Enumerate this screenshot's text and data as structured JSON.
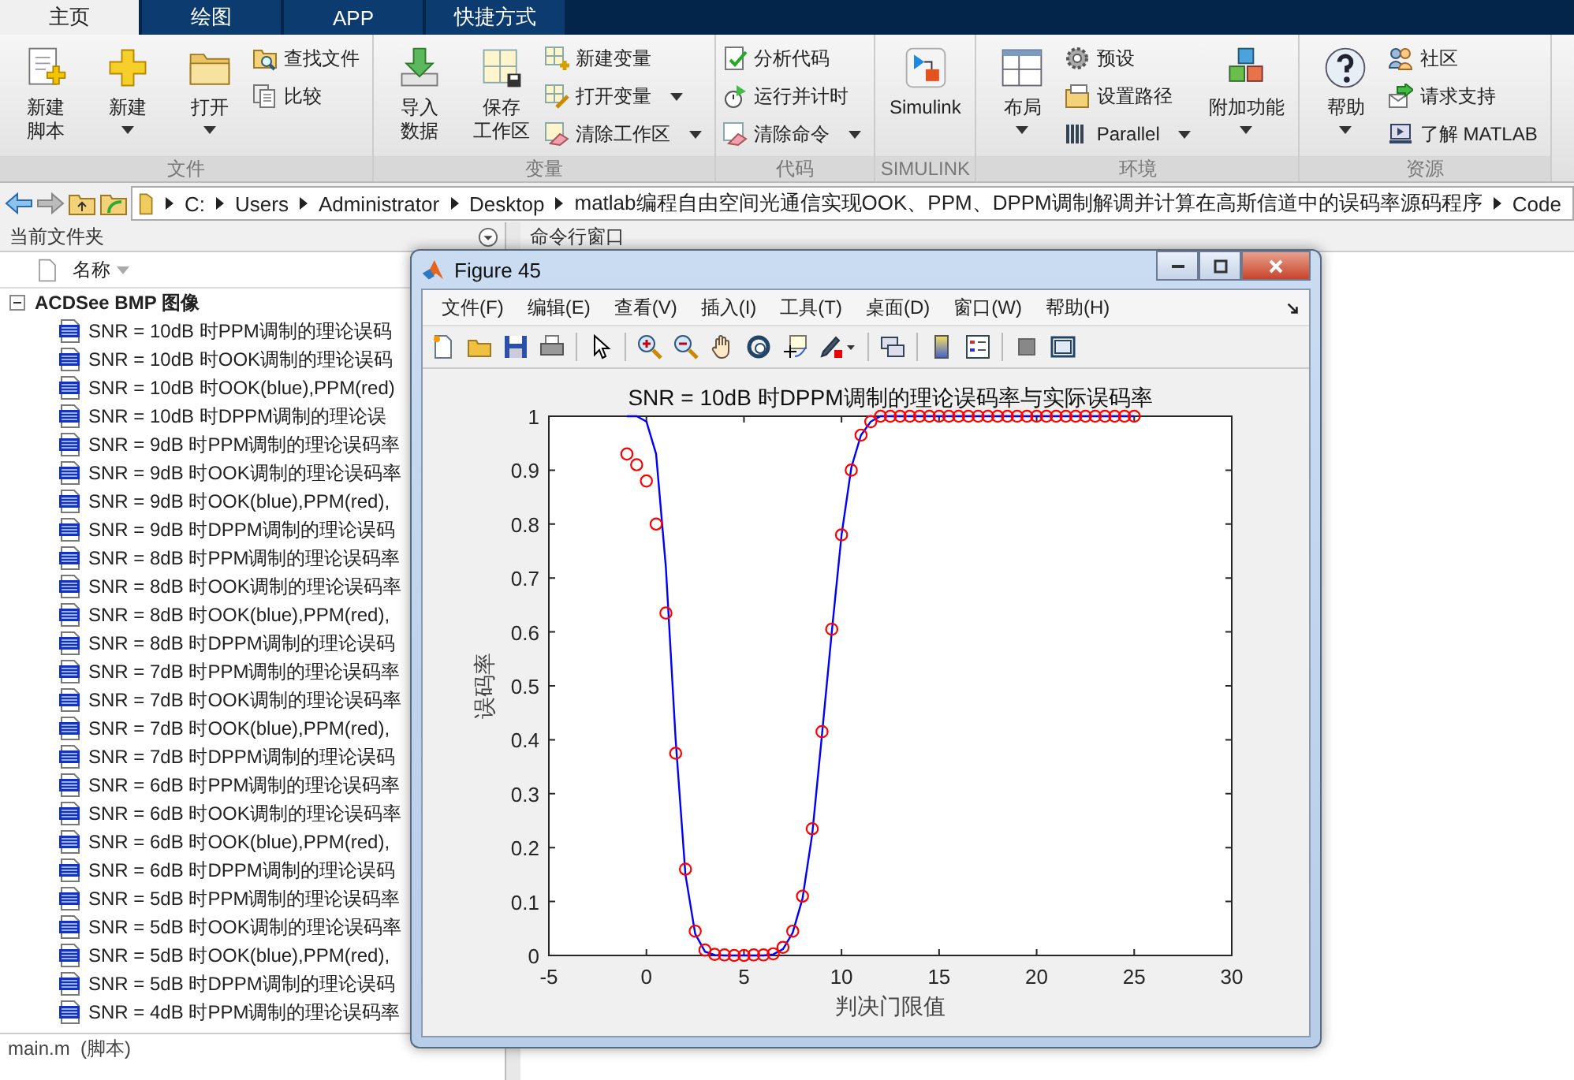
{
  "tabs": [
    {
      "label": "主页",
      "selected": true
    },
    {
      "label": "绘图",
      "selected": false
    },
    {
      "label": "APP",
      "selected": false
    },
    {
      "label": "快捷方式",
      "selected": false
    }
  ],
  "ribbon": {
    "groups": [
      {
        "label": "文件",
        "items": [
          {
            "kind": "large",
            "lines": [
              "新建",
              "脚本"
            ],
            "dropdown": false
          },
          {
            "kind": "large",
            "lines": [
              "新建"
            ],
            "dropdown": true
          },
          {
            "kind": "large",
            "lines": [
              "打开"
            ],
            "dropdown": true
          },
          {
            "kind": "small",
            "lines": [
              "查找文件"
            ],
            "dropdown": false
          },
          {
            "kind": "small",
            "lines": [
              "比较"
            ],
            "dropdown": false
          }
        ]
      },
      {
        "label": "变量",
        "items": [
          {
            "kind": "large",
            "lines": [
              "导入",
              "数据"
            ],
            "dropdown": false
          },
          {
            "kind": "large",
            "lines": [
              "保存",
              "工作区"
            ],
            "dropdown": false
          },
          {
            "kind": "small",
            "lines": [
              "新建变量"
            ],
            "dropdown": false
          },
          {
            "kind": "small",
            "lines": [
              "打开变量"
            ],
            "dropdown": true
          },
          {
            "kind": "small",
            "lines": [
              "清除工作区"
            ],
            "dropdown": true
          }
        ]
      },
      {
        "label": "代码",
        "items": [
          {
            "kind": "small",
            "lines": [
              "分析代码"
            ],
            "dropdown": false
          },
          {
            "kind": "small",
            "lines": [
              "运行并计时"
            ],
            "dropdown": false
          },
          {
            "kind": "small",
            "lines": [
              "清除命令"
            ],
            "dropdown": true
          }
        ]
      },
      {
        "label": "SIMULINK",
        "items": [
          {
            "kind": "large",
            "lines": [
              "Simulink"
            ],
            "dropdown": false
          }
        ]
      },
      {
        "label": "环境",
        "items": [
          {
            "kind": "large",
            "lines": [
              "布局"
            ],
            "dropdown": true
          },
          {
            "kind": "small",
            "lines": [
              "预设"
            ],
            "dropdown": false
          },
          {
            "kind": "small",
            "lines": [
              "设置路径"
            ],
            "dropdown": false
          },
          {
            "kind": "small",
            "lines": [
              "Parallel"
            ],
            "dropdown": true
          },
          {
            "kind": "large",
            "lines": [
              "附加功能"
            ],
            "dropdown": true
          }
        ]
      },
      {
        "label": "资源",
        "items": [
          {
            "kind": "large",
            "lines": [
              "帮助"
            ],
            "dropdown": true
          },
          {
            "kind": "small",
            "lines": [
              "社区"
            ],
            "dropdown": false
          },
          {
            "kind": "small",
            "lines": [
              "请求支持"
            ],
            "dropdown": false
          },
          {
            "kind": "small",
            "lines": [
              "了解 MATLAB"
            ],
            "dropdown": false
          }
        ]
      }
    ]
  },
  "address": {
    "segments": [
      "C:",
      "Users",
      "Administrator",
      "Desktop",
      "matlab编程自由空间光通信实现OOK、PPM、DPPM调制解调并计算在高斯信道中的误码率源码程序",
      "Code"
    ]
  },
  "file_panel": {
    "title": "当前文件夹",
    "column": "名称",
    "group": {
      "label": "ACDSee BMP 图像",
      "expanded": true,
      "items": [
        "SNR = 10dB 时PPM调制的理论误码",
        "SNR = 10dB 时OOK调制的理论误码",
        "SNR = 10dB 时OOK(blue),PPM(red)",
        "SNR = 10dB 时DPPM调制的理论误",
        "SNR = 9dB 时PPM调制的理论误码率",
        "SNR = 9dB 时OOK调制的理论误码率",
        "SNR = 9dB 时OOK(blue),PPM(red),",
        "SNR = 9dB 时DPPM调制的理论误码",
        "SNR = 8dB 时PPM调制的理论误码率",
        "SNR = 8dB 时OOK调制的理论误码率",
        "SNR = 8dB 时OOK(blue),PPM(red),",
        "SNR = 8dB 时DPPM调制的理论误码",
        "SNR = 7dB 时PPM调制的理论误码率",
        "SNR = 7dB 时OOK调制的理论误码率",
        "SNR = 7dB 时OOK(blue),PPM(red),",
        "SNR = 7dB 时DPPM调制的理论误码",
        "SNR = 6dB 时PPM调制的理论误码率",
        "SNR = 6dB 时OOK调制的理论误码率",
        "SNR = 6dB 时OOK(blue),PPM(red),",
        "SNR = 6dB 时DPPM调制的理论误码",
        "SNR = 5dB 时PPM调制的理论误码率",
        "SNR = 5dB 时OOK调制的理论误码率",
        "SNR = 5dB 时OOK(blue),PPM(red),",
        "SNR = 5dB 时DPPM调制的理论误码",
        "SNR = 4dB 时PPM调制的理论误码率"
      ]
    },
    "details": "main.m  (脚本)"
  },
  "command_window": {
    "title": "命令行窗口"
  },
  "figure": {
    "title": "Figure 45",
    "menu": [
      "文件(F)",
      "编辑(E)",
      "查看(V)",
      "插入(I)",
      "工具(T)",
      "桌面(D)",
      "窗口(W)",
      "帮助(H)"
    ],
    "chart_data": {
      "type": "line",
      "title": "SNR = 10dB 时DPPM调制的理论误码率与实际误码率",
      "xlabel": "判决门限值",
      "ylabel": "误码率",
      "x": [
        -1,
        -0.5,
        0,
        0.5,
        1,
        1.5,
        2,
        2.5,
        3,
        3.5,
        4,
        4.5,
        5,
        5.5,
        6,
        6.5,
        7,
        7.5,
        8,
        8.5,
        9,
        9.5,
        10,
        10.5,
        11,
        11.5,
        12,
        12.5,
        13,
        13.5,
        14,
        14.5,
        15,
        15.5,
        16,
        16.5,
        17,
        17.5,
        18,
        18.5,
        19,
        19.5,
        20,
        20.5,
        21,
        21.5,
        22,
        22.5,
        23,
        23.5,
        24,
        24.5,
        25
      ],
      "series": [
        {
          "type": "line",
          "color": "#0000ff",
          "values": [
            1,
            1,
            0.99,
            0.93,
            0.72,
            0.4,
            0.15,
            0.04,
            0.007,
            0.001,
            0,
            0,
            0,
            0,
            0,
            0.002,
            0.012,
            0.042,
            0.105,
            0.225,
            0.41,
            0.6,
            0.78,
            0.905,
            0.965,
            0.99,
            1,
            1,
            1,
            1,
            1,
            1,
            1,
            1,
            1,
            1,
            1,
            1,
            1,
            1,
            1,
            1,
            1,
            1,
            1,
            1,
            1,
            1,
            1,
            1,
            1,
            1,
            1
          ]
        },
        {
          "type": "scatter",
          "color": "#ff0000",
          "values": [
            0.93,
            0.91,
            0.88,
            0.8,
            0.635,
            0.375,
            0.16,
            0.045,
            0.01,
            0.002,
            0.001,
            0,
            0,
            0.001,
            0.001,
            0.003,
            0.015,
            0.045,
            0.11,
            0.235,
            0.415,
            0.605,
            0.78,
            0.9,
            0.965,
            0.99,
            1,
            1,
            1,
            1,
            1,
            1,
            1,
            1,
            1,
            1,
            1,
            1,
            1,
            1,
            1,
            1,
            1,
            1,
            1,
            1,
            1,
            1,
            1,
            1,
            1,
            1,
            1
          ]
        }
      ],
      "xlim": [
        -5,
        30
      ],
      "ylim": [
        0,
        1
      ],
      "xticks": [
        -5,
        0,
        5,
        10,
        15,
        20,
        25,
        30
      ],
      "yticks": [
        0,
        0.1,
        0.2,
        0.3,
        0.4,
        0.5,
        0.6,
        0.7,
        0.8,
        0.9,
        1
      ]
    }
  }
}
